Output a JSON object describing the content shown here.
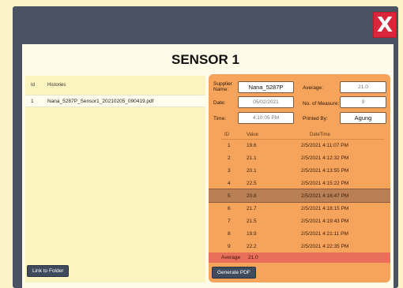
{
  "window": {
    "close_label": "X"
  },
  "title": "SENSOR 1",
  "histories": {
    "headers": {
      "id": "Id",
      "histories": "Histories"
    },
    "rows": [
      {
        "id": "1",
        "name": "Nana_5287P_Sensor1_20210205_090419.pdf"
      }
    ],
    "link_label": "Link to Folder"
  },
  "details": {
    "supplier_label": "Supplier Name:",
    "supplier_value": "Nana_5287P",
    "date_label": "Date:",
    "date_value": "05/02/2021",
    "time_label": "Time:",
    "time_value": "4:10:05 PM",
    "average_label": "Average:",
    "average_value": "21.0",
    "measures_label": "No. of Measure:",
    "measures_value": "9",
    "printed_label": "Printed By:",
    "printed_value": "Agung"
  },
  "grid": {
    "headers": {
      "id": "ID",
      "value": "Value",
      "datetime": "DateTime"
    },
    "rows": [
      {
        "id": "1",
        "value": "19.6",
        "datetime": "2/5/2021 4:11:07 PM"
      },
      {
        "id": "2",
        "value": "21.1",
        "datetime": "2/5/2021 4:12:32 PM"
      },
      {
        "id": "3",
        "value": "20.1",
        "datetime": "2/5/2021 4:13:55 PM"
      },
      {
        "id": "4",
        "value": "22.5",
        "datetime": "2/5/2021 4:15:22 PM"
      },
      {
        "id": "5",
        "value": "20.8",
        "datetime": "2/5/2021 4:16:47 PM"
      },
      {
        "id": "6",
        "value": "21.7",
        "datetime": "2/5/2021 4:18:15 PM"
      },
      {
        "id": "7",
        "value": "21.5",
        "datetime": "2/5/2021 4:19:43 PM"
      },
      {
        "id": "8",
        "value": "19.9",
        "datetime": "2/5/2021 4:21:11 PM"
      },
      {
        "id": "9",
        "value": "22.2",
        "datetime": "2/5/2021 4:22:35 PM"
      }
    ],
    "average_label": "Average",
    "average_value": "21.0"
  },
  "generate_label": "Generate PDF",
  "colors": {
    "accent": "#f6a35c",
    "selected_row": "#b97f55",
    "average_bar": "#e8705a",
    "close": "#d9263a"
  }
}
